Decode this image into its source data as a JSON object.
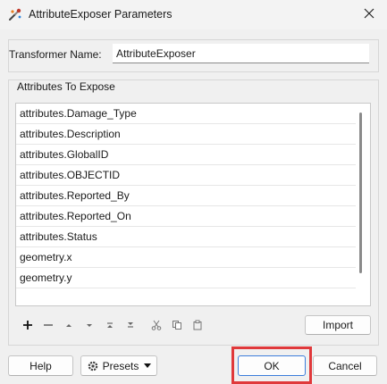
{
  "window": {
    "title": "AttributeExposer Parameters",
    "close_icon": "close-icon",
    "app_icon": "fme-transformer-icon"
  },
  "transformer": {
    "label": "Transformer Name:",
    "value": "AttributeExposer"
  },
  "attributes": {
    "group_label": "Attributes To Expose",
    "items": [
      "attributes.Damage_Type",
      "attributes.Description",
      "attributes.GlobalID",
      "attributes.OBJECTID",
      "attributes.Reported_By",
      "attributes.Reported_On",
      "attributes.Status",
      "geometry.x",
      "geometry.y"
    ]
  },
  "toolbar": {
    "icons": [
      "plus-icon",
      "minus-icon",
      "move-up-icon",
      "move-down-icon",
      "move-top-icon",
      "move-bottom-icon",
      "cut-icon",
      "copy-icon",
      "paste-icon"
    ],
    "import_label": "Import"
  },
  "buttons": {
    "help": "Help",
    "presets": "Presets",
    "ok": "OK",
    "cancel": "Cancel"
  },
  "colors": {
    "highlight": "#e0393b",
    "dialog_bg": "#f0f0f0"
  }
}
